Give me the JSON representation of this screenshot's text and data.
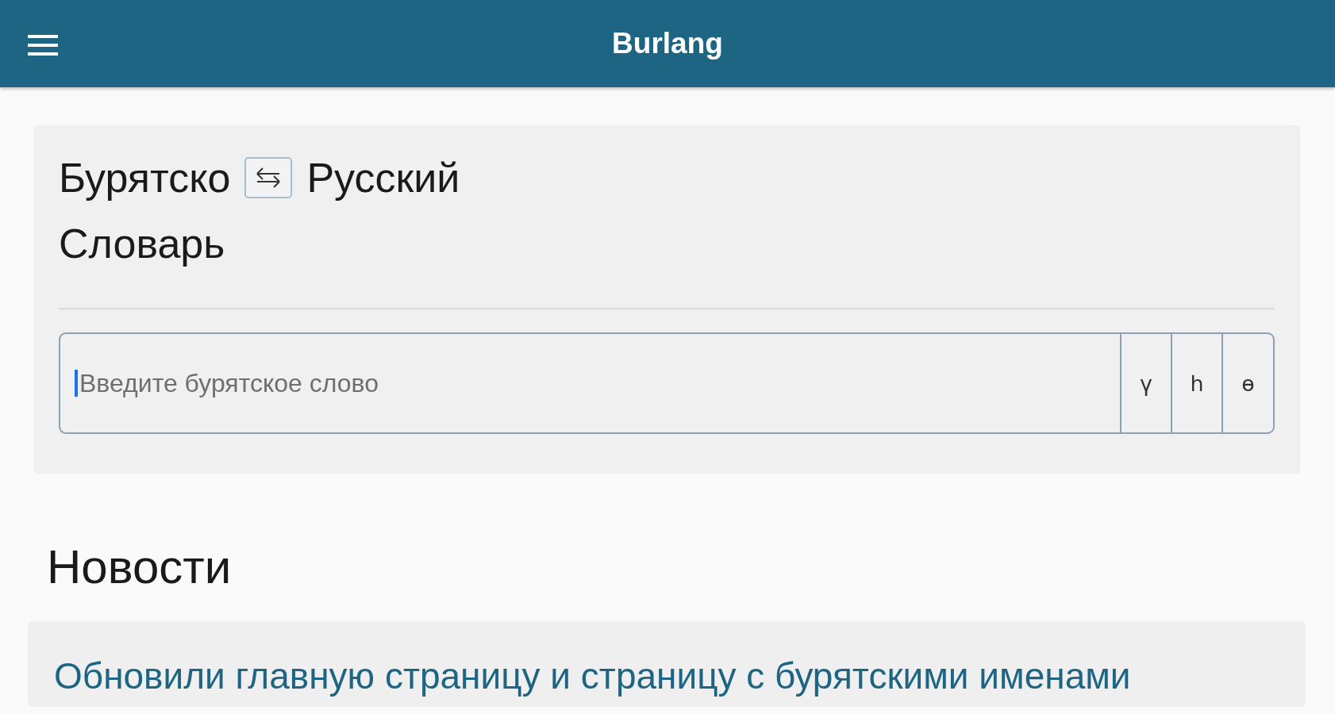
{
  "app_bar": {
    "title": "Burlang"
  },
  "dictionary": {
    "source_language": "Бурятско",
    "target_language": "Русский",
    "title": "Словарь",
    "search": {
      "placeholder": "Введите бурятское слово",
      "focused": true
    },
    "letter_keys": [
      "ү",
      "һ",
      "ө"
    ]
  },
  "news": {
    "heading": "Новости",
    "items": [
      {
        "title": "Обновили главную страницу и страницу с бурятскими именами"
      }
    ]
  }
}
